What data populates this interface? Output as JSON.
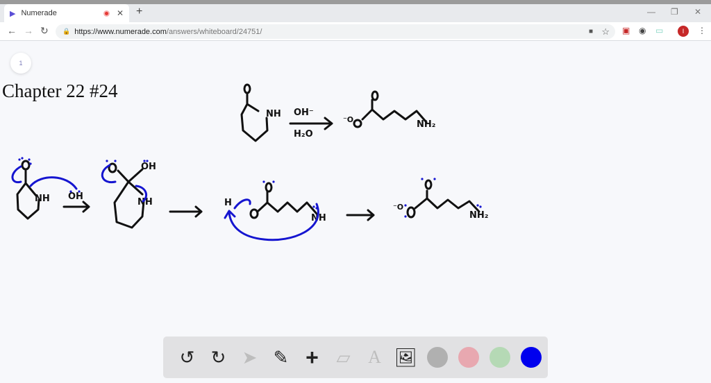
{
  "browser": {
    "tab_title": "Numerade",
    "url_host": "https://www.numerade.com",
    "url_path": "/answers/whiteboard/24751/",
    "avatar_initial": "I"
  },
  "page": {
    "page_number": "1",
    "title": "Chapter 22 #24"
  },
  "drawing": {
    "reagent_top": "OH⁻",
    "reagent_bottom": "H₂O",
    "nh": "NH",
    "nh2": "NH₂",
    "oh": "OH",
    "o_minus": "⁻O",
    "h": "H"
  },
  "toolbar": {
    "colors": [
      "#b0b0b0",
      "#e8a8b0",
      "#b5d9b5",
      "#0000ee"
    ],
    "selected_color": "#0000ee"
  }
}
